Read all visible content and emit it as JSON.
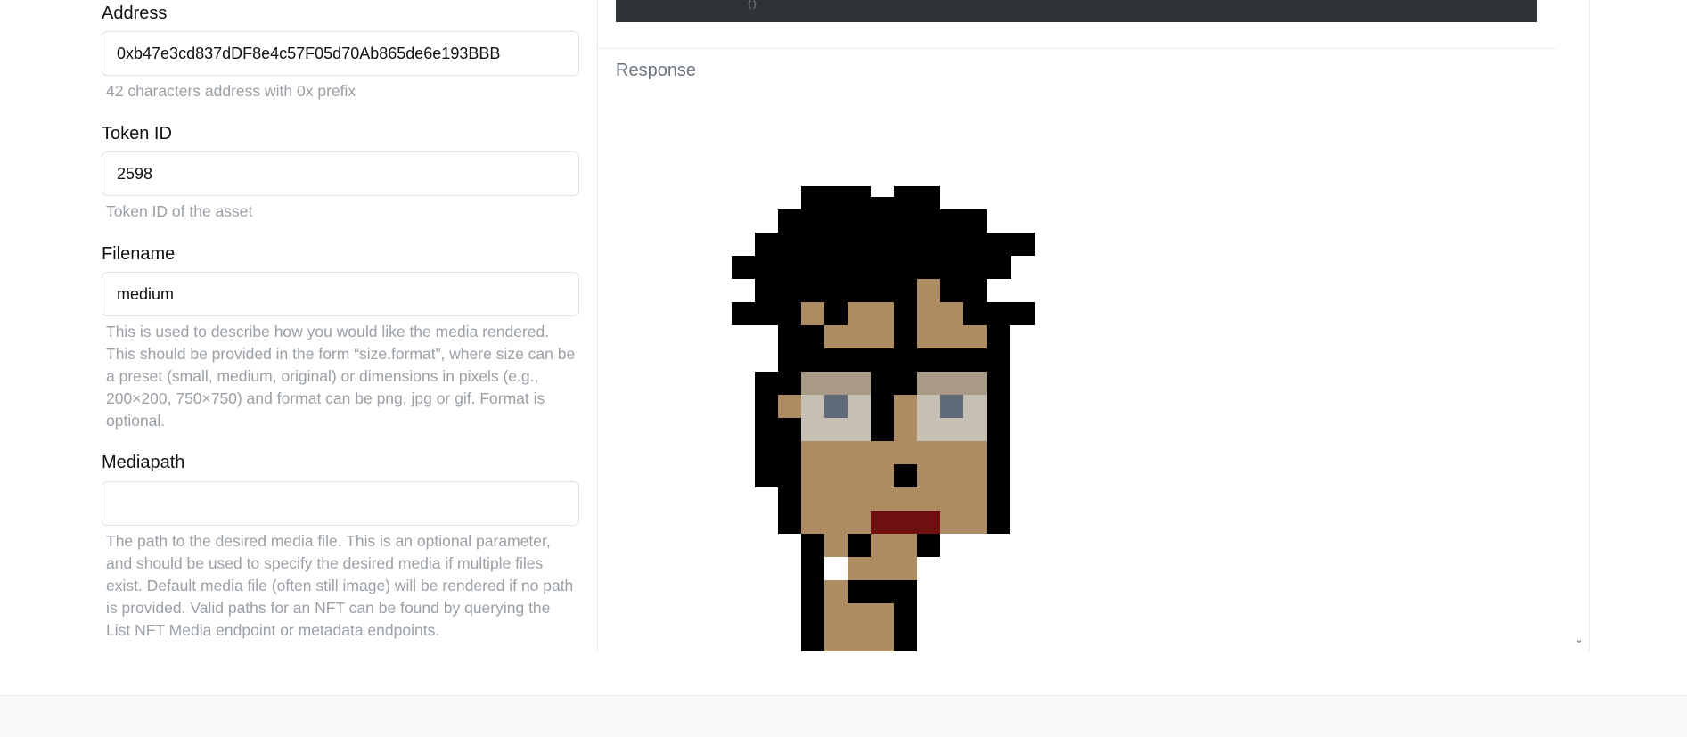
{
  "form": {
    "address": {
      "label": "Address",
      "value": "0xb47e3cd837dDF8e4c57F05d70Ab865de6e193BBB",
      "help": "42 characters address with 0x prefix"
    },
    "token_id": {
      "label": "Token ID",
      "value": "2598",
      "help": "Token ID of the asset"
    },
    "filename": {
      "label": "Filename",
      "value": "medium",
      "help_lines": [
        "This is used to describe how you would like the media rendered.",
        "This should be provided in the form “size.format”, where size can be",
        "a preset (small, medium, original) or dimensions in pixels (e.g.,",
        "200×200, 750×750) and format can be png, jpg or gif. Format is",
        "optional."
      ]
    },
    "mediapath": {
      "label": "Mediapath",
      "value": "",
      "help_lines": [
        "The path to the desired media file. This is an optional parameter,",
        "and should be used to specify the desired media if multiple files",
        "exist. Default media file (often still image) will be rendered if no path",
        "is provided. Valid paths for an NFT can be found by querying the",
        "List NFT Media endpoint or metadata endpoints."
      ]
    }
  },
  "response": {
    "label": "Response",
    "code_fragment": "{}"
  },
  "icons": {
    "scroll": "chevron-down-icon"
  },
  "colors": {
    "help_text": "#9aa0a6",
    "code_bg": "#2f3237",
    "skin": "#ae8b61",
    "hair": "#000000",
    "glasses": "#c6bfb3",
    "eye": "#5f6b78",
    "lips": "#711010"
  }
}
